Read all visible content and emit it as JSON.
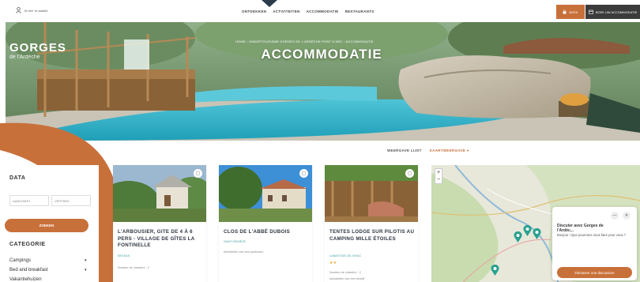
{
  "header": {
    "login_label": "Ik heb 'm claskie",
    "nav": [
      "ONTDEKKEN",
      "ACTIVITEITEN",
      "ACCOMMODATIE",
      "RESTAURANTS"
    ],
    "book_label": "BOEK",
    "book_now_label": "BOEK UW ACCOMMODATIE"
  },
  "hero": {
    "logo_line1": "GORGES",
    "logo_line2": "de l'Ardèche",
    "breadcrumb": "HOME › ONDERTOURISME GORGES DE L'ARDÈCHE PONT D'ARC › ACCOMMODATIE",
    "title": "ACCOMMODATIE"
  },
  "sort": {
    "list_label": "WEERGAVE LIJST",
    "map_label": "KAARTWEERGAVE"
  },
  "filter": {
    "dates_heading": "DATA",
    "arrival_placeholder": "AANKOMST",
    "departure_placeholder": "VERTREK",
    "search_label": "ZOEKEN",
    "category_heading": "CATEGORIE",
    "categories": [
      "Campings",
      "Bed and breakfast",
      "Vakantiehuizen"
    ]
  },
  "cards": [
    {
      "title": "L'ARBOUSIER, GITE DE 4 À 6 PERS - VILLAGE DE GÎTES LA FONTINELLE",
      "location": "BESSAS",
      "meta": "Nombre de chambre : 2"
    },
    {
      "title": "CLOS DE L'ABBÉ DUBOIS",
      "location": "SAINT-REMÈZE",
      "meta": "Activiteiten van een particulier"
    },
    {
      "title": "TENTES LODGE SUR PILOTIS AU CAMPING MILLE ÉTOILES",
      "location": "LABASTIDE-DE-VIRAC",
      "meta": "Nombre de chambre : 2",
      "meta2": "Activiteiten van een bedrijf",
      "stars": "★★"
    }
  ],
  "map": {
    "zoom_in": "+",
    "zoom_out": "−"
  },
  "chat": {
    "title": "Discuter avec Gorges de l'Ardèc...",
    "question": "Bonjour ! Que pourrions nous faire pour vous ?",
    "start_label": "Démarrer une discussion",
    "minimize": "—",
    "close": "✕"
  },
  "colors": {
    "accent": "#c8703a",
    "dark": "#3b3b3b",
    "teal": "#4aa5a6",
    "pin": "#2aa090"
  }
}
